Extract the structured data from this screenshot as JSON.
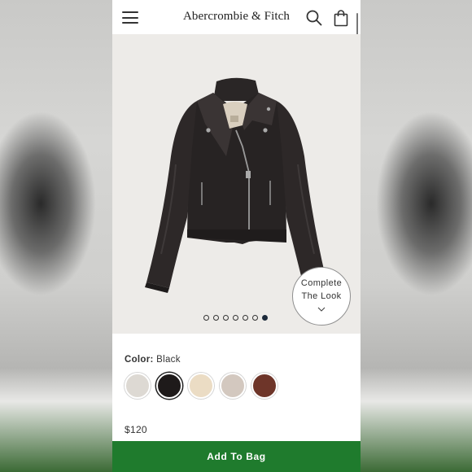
{
  "header": {
    "brand": "Abercrombie & Fitch",
    "menu_icon": "hamburger-menu-icon",
    "search_icon": "search-icon",
    "bag_icon": "shopping-bag-icon"
  },
  "gallery": {
    "complete_look_line1": "Complete",
    "complete_look_line2": "The Look",
    "complete_look_icon": "chevron-down-icon",
    "slide_count": 7,
    "active_slide": 7
  },
  "product": {
    "color_label": "Color:",
    "color_value": "Black",
    "swatches": [
      {
        "name": "Light Grey",
        "hex": "#ddd9d3",
        "selected": false
      },
      {
        "name": "Black",
        "hex": "#1e1a1a",
        "selected": true
      },
      {
        "name": "Cream",
        "hex": "#ebdcc4",
        "selected": false
      },
      {
        "name": "Taupe",
        "hex": "#d3c8bf",
        "selected": false
      },
      {
        "name": "Brown",
        "hex": "#6e3529",
        "selected": false
      }
    ],
    "price": "$120"
  },
  "cta": {
    "add_to_bag": "Add To Bag",
    "color": "#1f7b2d"
  }
}
